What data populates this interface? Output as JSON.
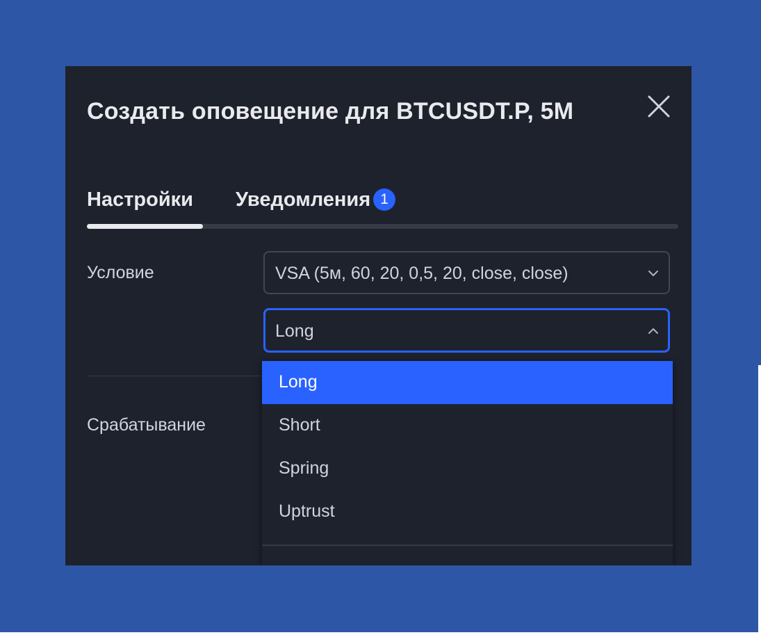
{
  "dialog": {
    "title": "Создать оповещение для BTCUSDT.P, 5M",
    "tabs": [
      {
        "label": "Настройки",
        "active": true
      },
      {
        "label": "Уведомления",
        "badge": "1"
      }
    ],
    "condition": {
      "label": "Условие",
      "indicator_value": "VSA (5м, 60, 20, 0,5, 20, close, close)",
      "signal_value": "Long"
    },
    "trigger": {
      "label": "Срабатывание"
    },
    "dropdown": {
      "options": [
        "Long",
        "Short",
        "Spring",
        "Uptrust"
      ],
      "selected": "Long"
    }
  },
  "colors": {
    "backdrop": "#2d57a6",
    "dialog_bg": "#1e222d",
    "accent": "#2962ff",
    "text": "#d1d4dc"
  },
  "icons": [
    "close-icon",
    "chevron-down-icon",
    "chevron-up-icon"
  ]
}
